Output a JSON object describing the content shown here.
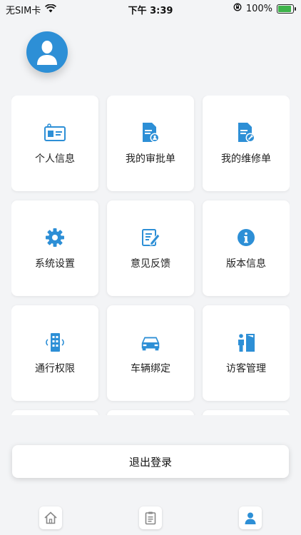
{
  "status_bar": {
    "carrier": "无SIM卡",
    "time": "下午 3:39",
    "battery": "100%",
    "battery_level": 1.0
  },
  "colors": {
    "accent": "#2d8fd6",
    "background": "#f3f4f6"
  },
  "menu": [
    {
      "label": "个人信息",
      "icon": "id-card-icon"
    },
    {
      "label": "我的审批单",
      "icon": "approval-document-icon"
    },
    {
      "label": "我的维修单",
      "icon": "repair-document-icon"
    },
    {
      "label": "系统设置",
      "icon": "gear-icon"
    },
    {
      "label": "意见反馈",
      "icon": "feedback-edit-icon"
    },
    {
      "label": "版本信息",
      "icon": "info-icon"
    },
    {
      "label": "通行权限",
      "icon": "access-building-icon"
    },
    {
      "label": "车辆绑定",
      "icon": "car-icon"
    },
    {
      "label": "访客管理",
      "icon": "visitor-door-icon"
    }
  ],
  "logout_label": "退出登录",
  "tabs": [
    {
      "icon": "home-icon"
    },
    {
      "icon": "clipboard-icon"
    },
    {
      "icon": "user-icon"
    }
  ]
}
